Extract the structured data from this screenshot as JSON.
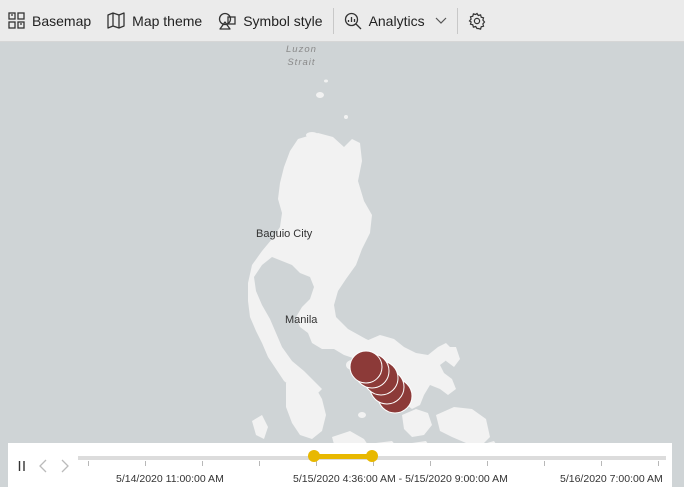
{
  "toolbar": {
    "basemap_label": "Basemap",
    "map_theme_label": "Map theme",
    "symbol_style_label": "Symbol style",
    "analytics_label": "Analytics"
  },
  "map": {
    "labels": {
      "luzon_strait_1": "Luzon",
      "luzon_strait_2": "Strait",
      "baguio": "Baguio City",
      "manila": "Manila"
    },
    "bubble_color": "#8c3a38",
    "land_color": "#f2f2f2",
    "water_color": "#cfd4d6"
  },
  "timeline": {
    "start_label": "5/14/2020 11:00:00 AM",
    "range_label": "5/15/2020 4:36:00 AM - 5/15/2020 9:00:00 AM",
    "end_label": "5/16/2020 7:00:00 AM",
    "accent_color": "#e8b800"
  }
}
